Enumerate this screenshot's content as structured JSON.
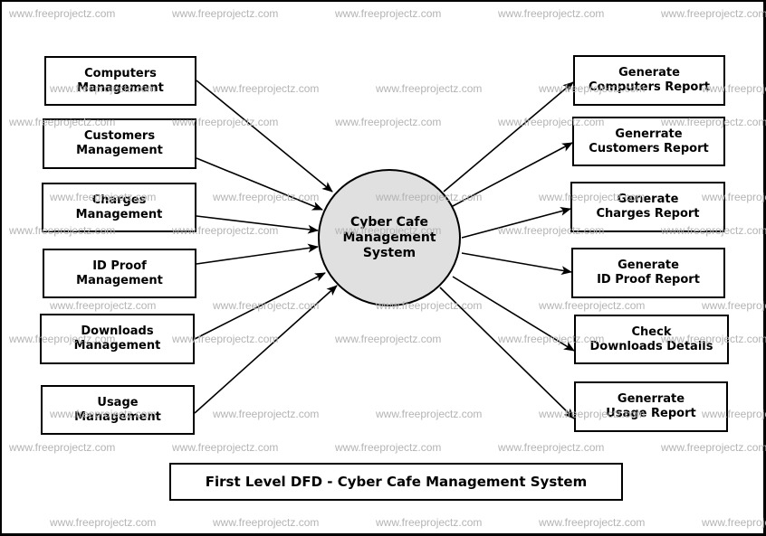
{
  "diagram": {
    "type": "First Level Data Flow Diagram",
    "title": "First Level DFD - Cyber Cafe Management System",
    "process": {
      "lines": [
        "Cyber Cafe",
        "Management",
        "System"
      ],
      "fill_color": "#e0e0e0"
    },
    "inputs": [
      {
        "id": "computers-management",
        "lines": [
          "Computers",
          "Management"
        ]
      },
      {
        "id": "customers-management",
        "lines": [
          "Customers",
          "Management"
        ]
      },
      {
        "id": "charges-management",
        "lines": [
          "Charges",
          "Management"
        ]
      },
      {
        "id": "id-proof-management",
        "lines": [
          "ID Proof",
          "Management"
        ]
      },
      {
        "id": "downloads-management",
        "lines": [
          "Downloads",
          "Management"
        ]
      },
      {
        "id": "usage-management",
        "lines": [
          "Usage",
          "Management"
        ]
      }
    ],
    "outputs": [
      {
        "id": "generate-computers-report",
        "lines": [
          "Generate",
          "Computers Report"
        ]
      },
      {
        "id": "generrate-customers-report",
        "lines": [
          "Generrate",
          "Customers Report"
        ]
      },
      {
        "id": "generate-charges-report",
        "lines": [
          "Generate",
          "Charges Report"
        ]
      },
      {
        "id": "generate-id-proof-report",
        "lines": [
          "Generate",
          "ID Proof Report"
        ]
      },
      {
        "id": "check-downloads-details",
        "lines": [
          "Check",
          "Downloads Details"
        ]
      },
      {
        "id": "generrate-usage-report",
        "lines": [
          "Generrate",
          "Usage Report"
        ]
      }
    ],
    "flows": [
      {
        "from": "computers-management",
        "to": "process"
      },
      {
        "from": "customers-management",
        "to": "process"
      },
      {
        "from": "charges-management",
        "to": "process"
      },
      {
        "from": "id-proof-management",
        "to": "process"
      },
      {
        "from": "downloads-management",
        "to": "process"
      },
      {
        "from": "usage-management",
        "to": "process"
      },
      {
        "from": "process",
        "to": "generate-computers-report"
      },
      {
        "from": "process",
        "to": "generrate-customers-report"
      },
      {
        "from": "process",
        "to": "generate-charges-report"
      },
      {
        "from": "process",
        "to": "generate-id-proof-report"
      },
      {
        "from": "process",
        "to": "check-downloads-details"
      },
      {
        "from": "process",
        "to": "generrate-usage-report"
      }
    ]
  },
  "watermark": {
    "text": "www.freeprojectz.com",
    "color": "#b4b4b4"
  }
}
